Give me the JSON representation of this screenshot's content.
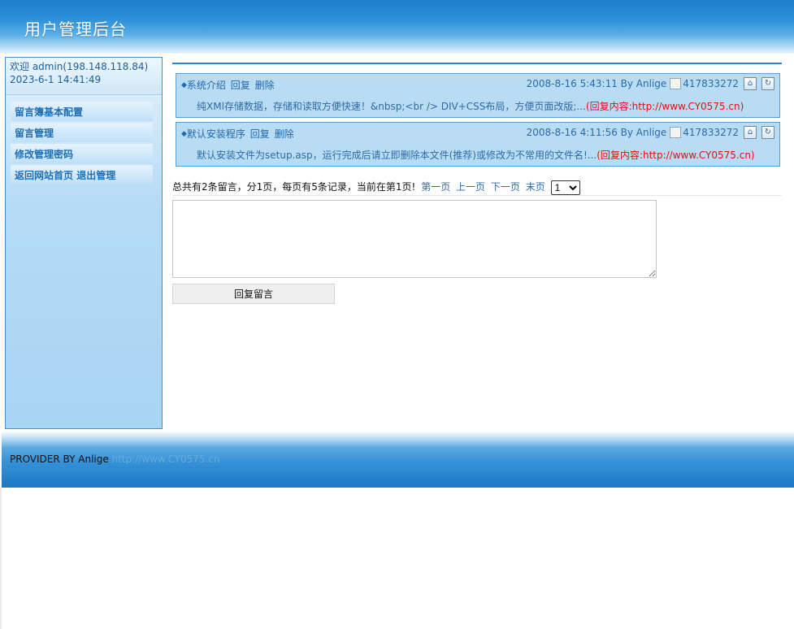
{
  "header": {
    "title": "用户管理后台"
  },
  "sidebar": {
    "welcome_line1": "欢迎 admin(198.148.118.84)",
    "welcome_line2": "2023-6-1 14:41:49",
    "menu": [
      {
        "label": "留言簿基本配置"
      },
      {
        "label": "留言管理"
      },
      {
        "label": "修改管理密码"
      },
      {
        "label_home": "返回网站首页",
        "label_logout": "退出管理"
      }
    ]
  },
  "messages": [
    {
      "title": "系统介绍",
      "reply_label": "回复",
      "delete_label": "删除",
      "meta": "2008-8-16 5:43:11 By Anlige",
      "qq": "417833272",
      "body": "纯XMl存储数据，存储和读取方便快速！&nbsp;<br /> DIV+CSS布局，方便页面改版;...",
      "reply_text": "(回复内容:http://www.CY0575.cn)"
    },
    {
      "title": "默认安装程序",
      "reply_label": "回复",
      "delete_label": "删除",
      "meta": "2008-8-16 4:11:56 By Anlige",
      "qq": "417833272",
      "body": "默认安装文件为setup.asp，运行完成后请立即删除本文件(推荐)或修改为不常用的文件名!...",
      "reply_text": "(回复内容:http://www.CY0575.cn)"
    }
  ],
  "pager": {
    "summary": "总共有2条留言，分1页，每页有5条记录，当前在第1页!",
    "first": "第一页",
    "prev": "上一页",
    "next": "下一页",
    "last": "末页",
    "selected_page": "1"
  },
  "reply_form": {
    "textarea_value": "",
    "button_label": "回复留言"
  },
  "footer": {
    "provider": "PROVIDER BY Anlige",
    "link": "http://www.CY0575.cn"
  },
  "colors": {
    "accent": "#2a86c9",
    "panel": "#b9dcf5",
    "reply_red": "#e01010",
    "link_blue": "#2d6db0"
  }
}
